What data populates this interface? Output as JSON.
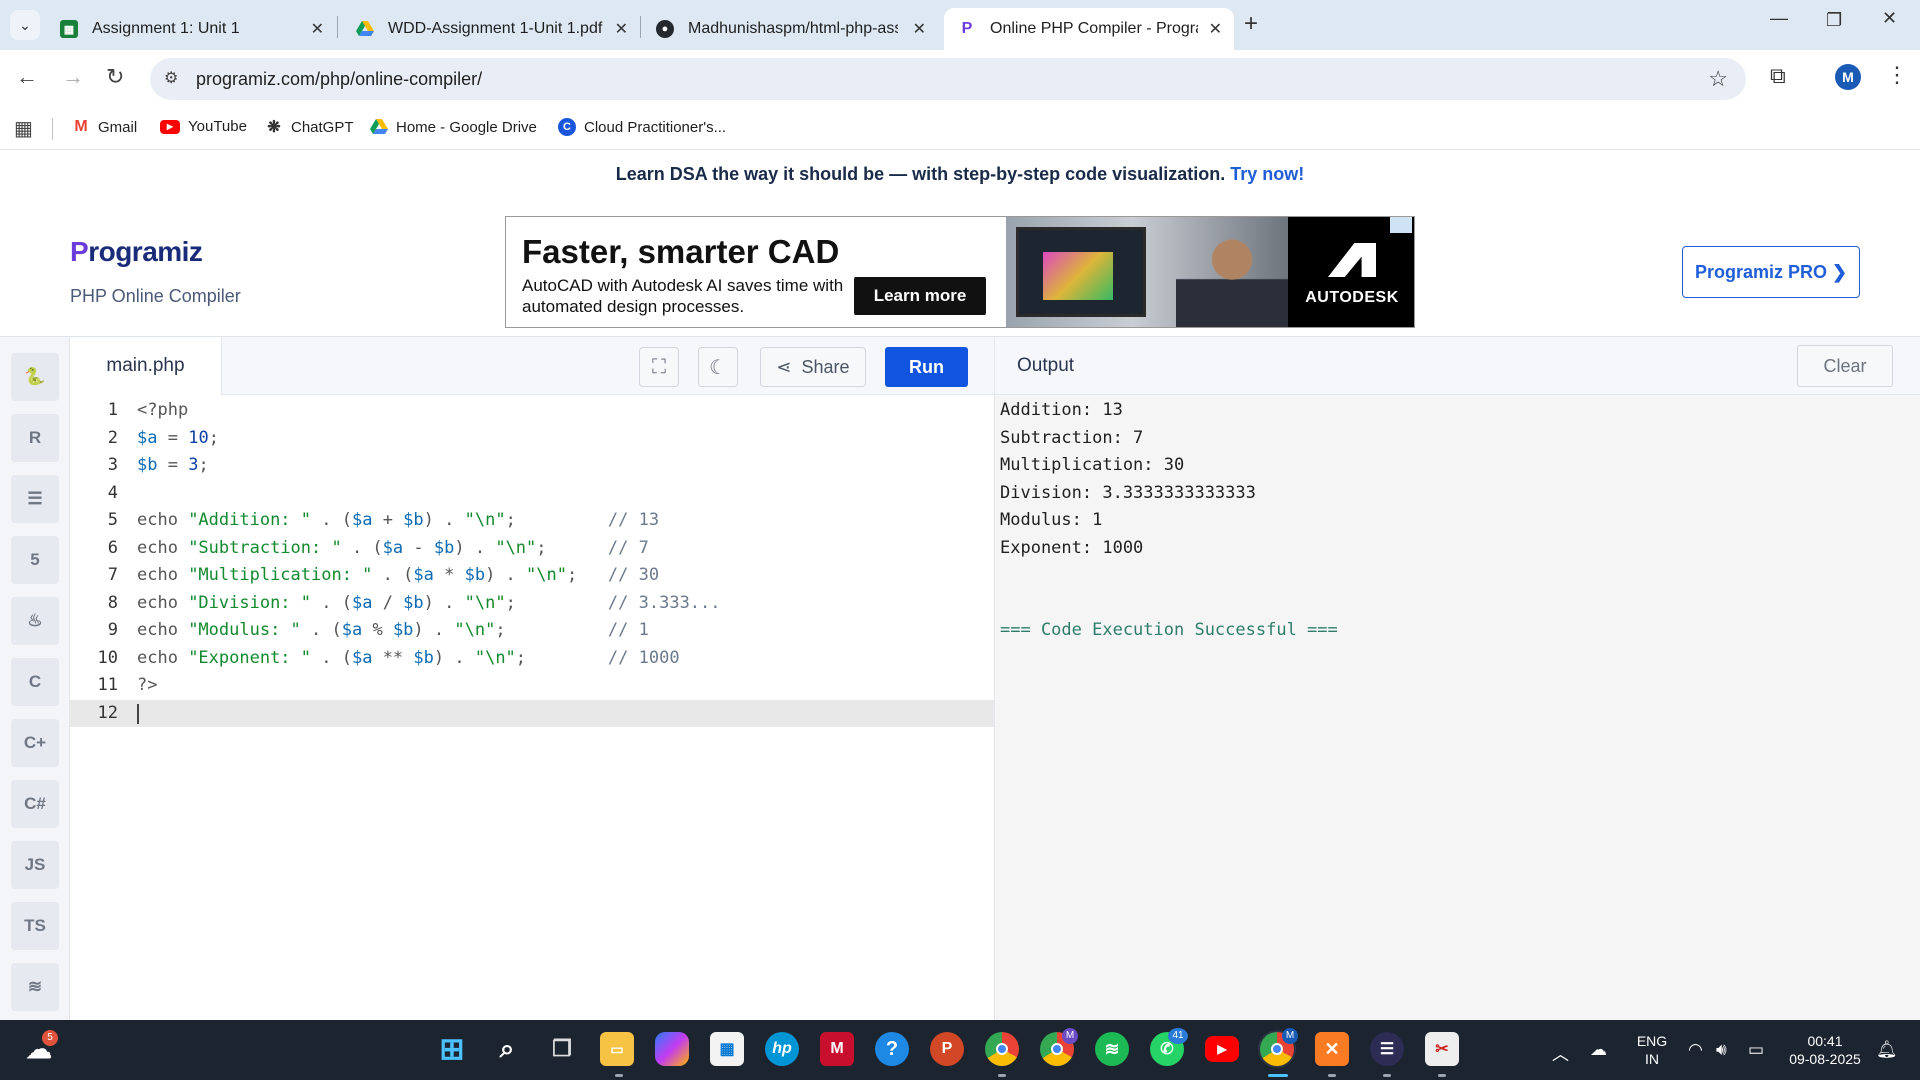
{
  "browser": {
    "tabs": [
      {
        "title": "Assignment 1: Unit 1",
        "icon": "sheets-icon",
        "color": "#188038"
      },
      {
        "title": "WDD-Assignment 1-Unit 1.pdf",
        "icon": "drive-icon",
        "color": "#1a73e8"
      },
      {
        "title": "Madhunishaspm/html-php-assi",
        "icon": "github-icon",
        "color": "#24292f"
      },
      {
        "title": "Online PHP Compiler - Program",
        "icon": "programiz-icon",
        "color": "#6c3bdc"
      }
    ],
    "url": "programiz.com/php/online-compiler/",
    "profile_initial": "M",
    "bookmarks": [
      {
        "label": "Gmail",
        "icon": "gmail-icon",
        "color": "#ea4335"
      },
      {
        "label": "YouTube",
        "icon": "youtube-icon",
        "color": "#ff0000"
      },
      {
        "label": "ChatGPT",
        "icon": "chatgpt-icon",
        "color": "#333333"
      },
      {
        "label": "Home - Google Drive",
        "icon": "drive-icon",
        "color": "#1a73e8"
      },
      {
        "label": "Cloud Practitioner's...",
        "icon": "c-icon",
        "color": "#1a56db"
      }
    ]
  },
  "promo": {
    "text": "Learn DSA the way it should be — with step-by-step code visualization.",
    "link": "Try now!"
  },
  "brand": {
    "logo_p": "P",
    "logo_rest": "rogramiz",
    "subtitle": "PHP Online Compiler",
    "pro_button": "Programiz PRO ❯"
  },
  "ad": {
    "headline": "Faster, smarter CAD",
    "body": "AutoCAD with Autodesk AI saves time with automated design processes.",
    "cta": "Learn more",
    "brand": "AUTODESK"
  },
  "rail": [
    "python-icon",
    "r-icon",
    "sql-icon",
    "html5-icon",
    "java-icon",
    "c-icon",
    "cpp-icon",
    "csharp-icon",
    "JS",
    "TS",
    "swift-icon"
  ],
  "editor": {
    "filename": "main.php",
    "share_label": "Share",
    "run_label": "Run",
    "current_line": 12,
    "lines": [
      [
        [
          "<?php",
          "op"
        ]
      ],
      [
        [
          "$a",
          "var"
        ],
        [
          " = ",
          "op"
        ],
        [
          "10",
          "num"
        ],
        [
          ";",
          "op"
        ]
      ],
      [
        [
          "$b",
          "var"
        ],
        [
          " = ",
          "op"
        ],
        [
          "3",
          "num"
        ],
        [
          ";",
          "op"
        ]
      ],
      [],
      [
        [
          "echo ",
          "op"
        ],
        [
          "\"Addition: \"",
          "str"
        ],
        [
          " . (",
          "op"
        ],
        [
          "$a",
          "var"
        ],
        [
          " + ",
          "op"
        ],
        [
          "$b",
          "var"
        ],
        [
          ") . ",
          "op"
        ],
        [
          "\"\\n\"",
          "str"
        ],
        [
          ";         ",
          "op"
        ],
        [
          "// 13",
          "com"
        ]
      ],
      [
        [
          "echo ",
          "op"
        ],
        [
          "\"Subtraction: \"",
          "str"
        ],
        [
          " . (",
          "op"
        ],
        [
          "$a",
          "var"
        ],
        [
          " - ",
          "op"
        ],
        [
          "$b",
          "var"
        ],
        [
          ") . ",
          "op"
        ],
        [
          "\"\\n\"",
          "str"
        ],
        [
          ";      ",
          "op"
        ],
        [
          "// 7",
          "com"
        ]
      ],
      [
        [
          "echo ",
          "op"
        ],
        [
          "\"Multiplication: \"",
          "str"
        ],
        [
          " . (",
          "op"
        ],
        [
          "$a",
          "var"
        ],
        [
          " * ",
          "op"
        ],
        [
          "$b",
          "var"
        ],
        [
          ") . ",
          "op"
        ],
        [
          "\"\\n\"",
          "str"
        ],
        [
          ";   ",
          "op"
        ],
        [
          "// 30",
          "com"
        ]
      ],
      [
        [
          "echo ",
          "op"
        ],
        [
          "\"Division: \"",
          "str"
        ],
        [
          " . (",
          "op"
        ],
        [
          "$a",
          "var"
        ],
        [
          " / ",
          "op"
        ],
        [
          "$b",
          "var"
        ],
        [
          ") . ",
          "op"
        ],
        [
          "\"\\n\"",
          "str"
        ],
        [
          ";         ",
          "op"
        ],
        [
          "// 3.333...",
          "com"
        ]
      ],
      [
        [
          "echo ",
          "op"
        ],
        [
          "\"Modulus: \"",
          "str"
        ],
        [
          " . (",
          "op"
        ],
        [
          "$a",
          "var"
        ],
        [
          " % ",
          "op"
        ],
        [
          "$b",
          "var"
        ],
        [
          ") . ",
          "op"
        ],
        [
          "\"\\n\"",
          "str"
        ],
        [
          ";          ",
          "op"
        ],
        [
          "// 1",
          "com"
        ]
      ],
      [
        [
          "echo ",
          "op"
        ],
        [
          "\"Exponent: \"",
          "str"
        ],
        [
          " . (",
          "op"
        ],
        [
          "$a",
          "var"
        ],
        [
          " ** ",
          "op"
        ],
        [
          "$b",
          "var"
        ],
        [
          ") . ",
          "op"
        ],
        [
          "\"\\n\"",
          "str"
        ],
        [
          ";        ",
          "op"
        ],
        [
          "// 1000",
          "com"
        ]
      ],
      [
        [
          "?>",
          "op"
        ]
      ],
      []
    ]
  },
  "output": {
    "title": "Output",
    "clear_label": "Clear",
    "lines": [
      "Addition: 13",
      "Subtraction: 7",
      "Multiplication: 30",
      "Division: 3.3333333333333",
      "Modulus: 1",
      "Exponent: 1000",
      "",
      "",
      "=== Code Execution Successful ==="
    ]
  },
  "taskbar": {
    "weather_badge": "5",
    "whatsapp_badge": "41",
    "chrome_badge": "M",
    "language": "ENG",
    "region": "IN",
    "time": "00:41",
    "date": "09-08-2025",
    "apps": [
      "start-icon",
      "search-icon",
      "task-view-icon",
      "file-explorer-icon",
      "copilot-icon",
      "store-icon",
      "hp-icon",
      "mcafee-icon",
      "help-icon",
      "powerpoint-icon",
      "chrome-icon",
      "chrome-profile-icon",
      "spotify-icon",
      "whatsapp-icon",
      "youtube-icon",
      "xampp-icon",
      "terminal-icon",
      "snipping-icon"
    ]
  }
}
